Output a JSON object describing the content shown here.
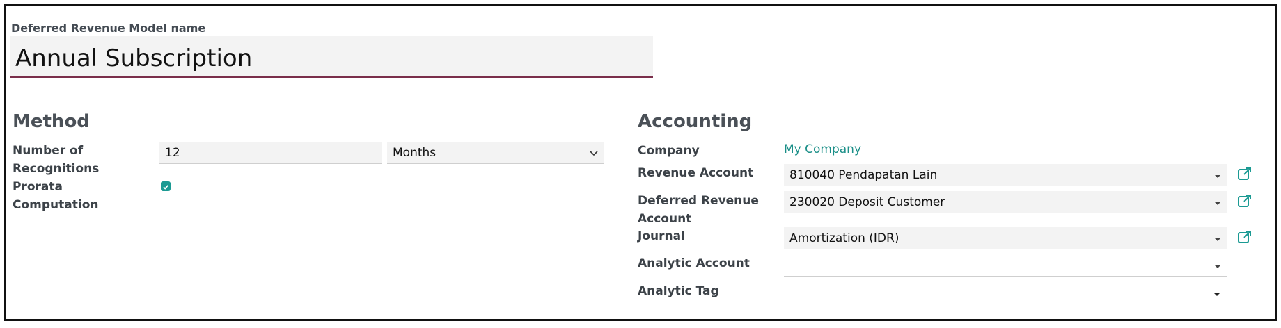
{
  "form": {
    "model_name_label": "Deferred Revenue Model name",
    "model_name_value": "Annual Subscription"
  },
  "method": {
    "title": "Method",
    "recognitions_label_line1": "Number of",
    "recognitions_label_line2": "Recognitions",
    "recognitions_value": "12",
    "period_unit": "Months",
    "prorata_label_line1": "Prorata",
    "prorata_label_line2": "Computation",
    "prorata_checked": true
  },
  "accounting": {
    "title": "Accounting",
    "company_label": "Company",
    "company_value": "My Company",
    "revenue_account_label": "Revenue Account",
    "revenue_account_value": "810040 Pendapatan Lain",
    "deferred_revenue_label_line1": "Deferred Revenue",
    "deferred_revenue_label_line2": "Account",
    "deferred_revenue_value": "230020 Deposit Customer",
    "journal_label": "Journal",
    "journal_value": "Amortization (IDR)",
    "analytic_account_label": "Analytic Account",
    "analytic_account_value": "",
    "analytic_tag_label": "Analytic Tag",
    "analytic_tag_value": ""
  },
  "colors": {
    "accent": "#1b9a93",
    "title_underline": "#7a2e4a",
    "field_background": "#f3f3f3"
  },
  "icons": {
    "dropdown": "caret-down-icon",
    "external": "external-link-icon",
    "check": "check-icon"
  }
}
